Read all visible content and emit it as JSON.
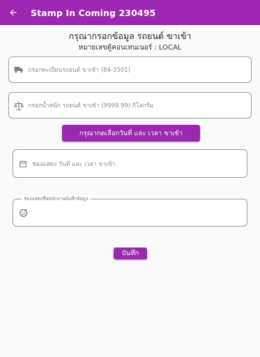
{
  "appbar": {
    "title": "Stamp In Coming 230495",
    "back_icon": "arrow-left-icon"
  },
  "form": {
    "heading": "กรุณากรอกข้อมูล รถยนต์ ขาเข้า",
    "subheading": "หมายเลขตู้คอนเทนเนอร์ : LOCAL",
    "plate_placeholder": "กรอกทะเบียนรถยนต์ ขาเข้า (84-3501)",
    "weight_placeholder": "กรอกน้ำหนัก รถยนต์ ขาเข้า (9999.99) กิโลกรัม",
    "pick_datetime_label": "กรุณากดเลือกวันที่ และ เวลา ขาเข้า",
    "datetime_placeholder": "ช่องแสดง วันที่ และ เวลา ขาเข้า",
    "recorder_label": "ช่องแสดงชื่อพนักงานบันทึกข้อมูล",
    "save_label": "บันทึก"
  },
  "colors": {
    "primary": "#9c27b0",
    "border": "#9e9e9e",
    "hint": "#8a8a8a"
  }
}
